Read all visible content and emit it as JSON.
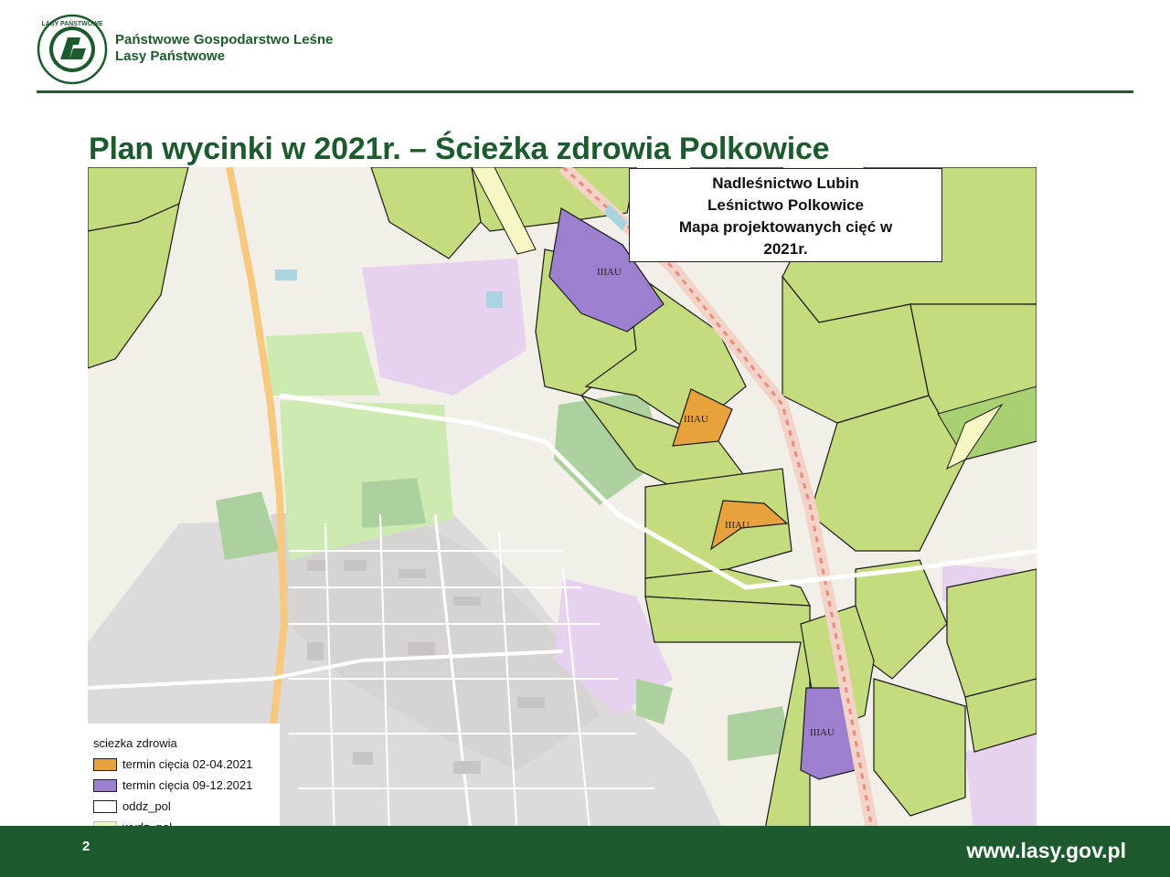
{
  "header": {
    "logo_text": "LASY PAŃSTWOWE",
    "org_line1": "Państwowe Gospodarstwo Leśne",
    "org_line2": "Lasy Państwowe"
  },
  "slide": {
    "title": "Plan wycinki w 2021r. – Ścieżka zdrowia Polkowice",
    "page_number": "2"
  },
  "map": {
    "info_box": {
      "line1": "Nadleśnictwo Lubin",
      "line2": "Leśnictwo Polkowice",
      "line3": "Mapa projektowanych cięć w",
      "line4": "2021r."
    },
    "cut_labels": [
      "IIIAU",
      "IIIAU",
      "IIIAU",
      "IIIAU"
    ],
    "colors": {
      "forest": "#c4dc7e",
      "forest_dark": "#a8cf72",
      "cut_orange": "#e8a23c",
      "cut_purple": "#9d7fd0",
      "residential": "#dcdada",
      "commercial": "#e6d1ee",
      "allotments": "#cdebb0",
      "park": "#add19e",
      "road_major": "#f7c97e"
    }
  },
  "legend": {
    "title": "sciezka zdrowia",
    "items": [
      {
        "label": "termin cięcia  02-04.2021",
        "color": "#e8a23c"
      },
      {
        "label": "termin cięcia  09-12.2021",
        "color": "#9d7fd0"
      },
      {
        "label": "oddz_pol",
        "color": "#ffffff"
      },
      {
        "label": "wydz_pol",
        "color": "#f7f7c6"
      }
    ]
  },
  "footer": {
    "url": "www.lasy.gov.pl"
  }
}
